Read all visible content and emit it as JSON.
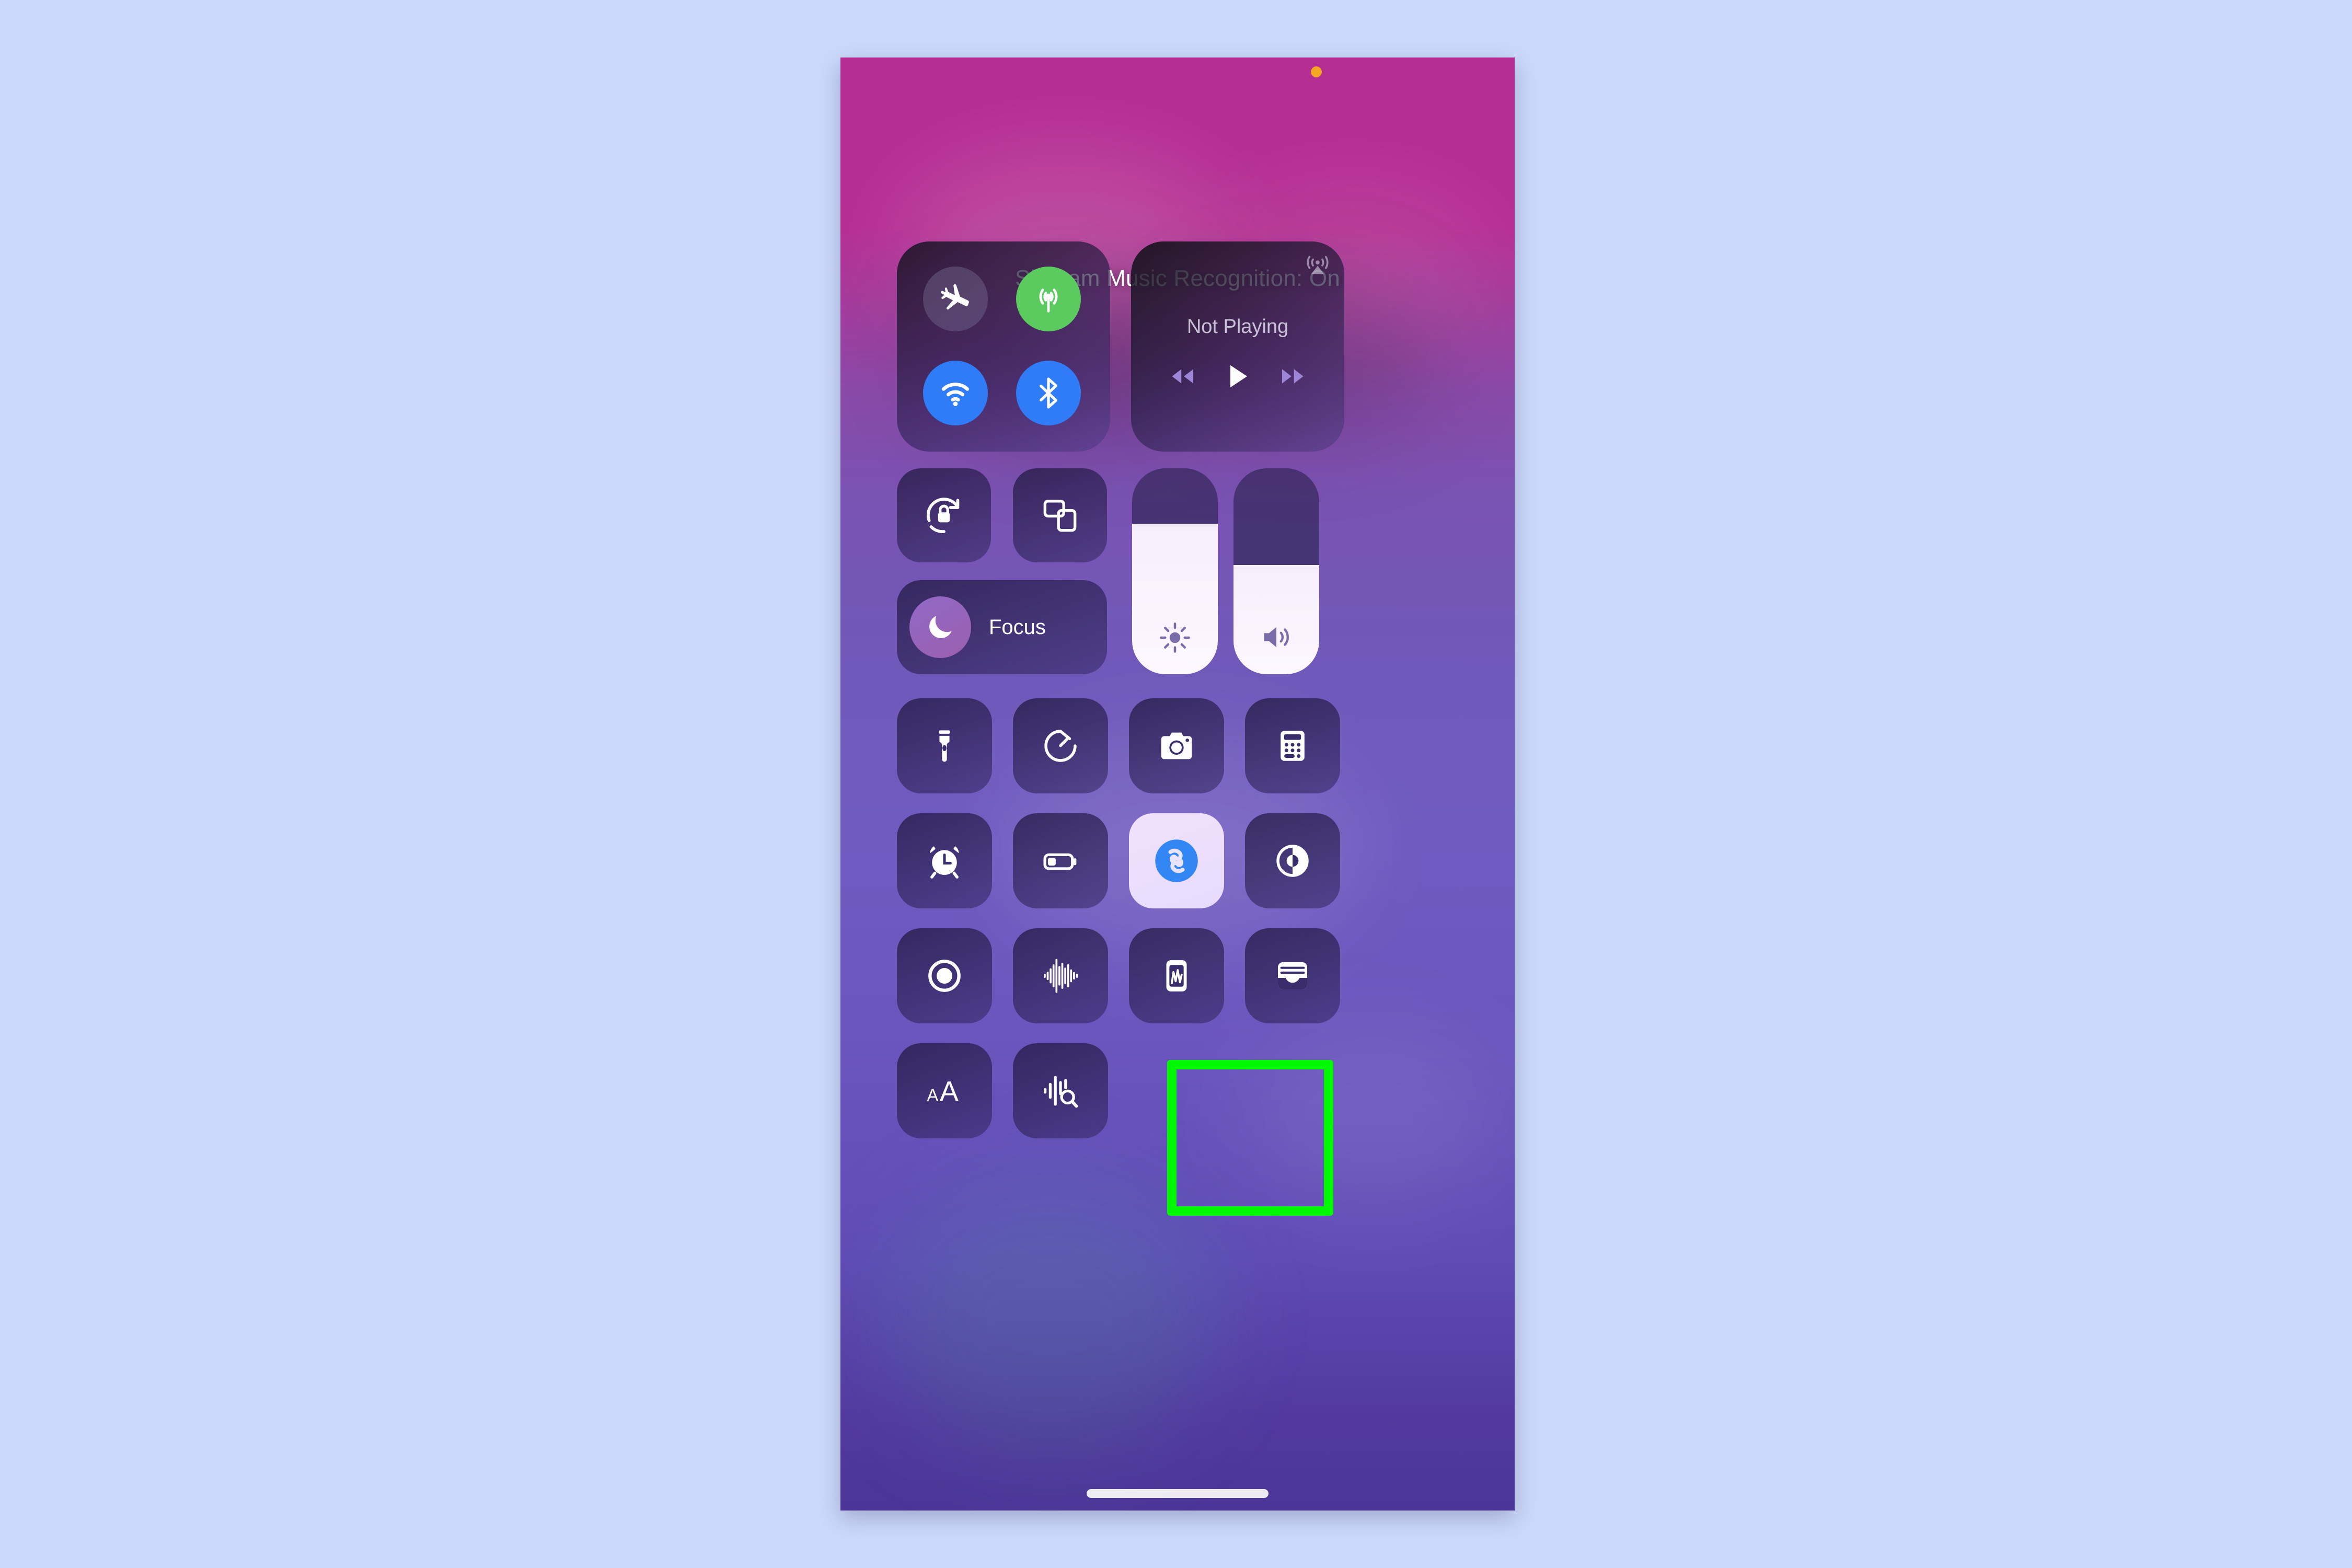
{
  "page": {
    "background_color": "#ccd9fa",
    "device": "iPhone Control Center"
  },
  "screen": {
    "gradient_top_color": "#b52e93",
    "gradient_bottom_color": "#4c3597"
  },
  "status": {
    "banner_text": "Shazam Music Recognition: On",
    "privacy_indicator": "microphone-in-use-dot",
    "privacy_indicator_color": "#f5a623"
  },
  "connectivity": {
    "toggles": [
      {
        "name": "airplane-mode",
        "label": "Airplane Mode",
        "state": "off",
        "color": "#787096"
      },
      {
        "name": "cellular-data",
        "label": "Cellular Data",
        "state": "on",
        "color": "#5bcb5f"
      },
      {
        "name": "wifi",
        "label": "Wi-Fi",
        "state": "on",
        "color": "#2f7cf6"
      },
      {
        "name": "bluetooth",
        "label": "Bluetooth",
        "state": "on",
        "color": "#2f7cf6"
      }
    ]
  },
  "media": {
    "title": "Not Playing",
    "airplay_label": "AirPlay",
    "controls": [
      {
        "name": "rewind",
        "label": "Rewind"
      },
      {
        "name": "play",
        "label": "Play"
      },
      {
        "name": "fast-forward",
        "label": "Fast Forward"
      }
    ]
  },
  "quick_controls": {
    "rotation_lock": {
      "label": "Portrait Orientation Lock",
      "state": "off"
    },
    "screen_mirroring": {
      "label": "Screen Mirroring",
      "state": "off"
    },
    "focus": {
      "label": "Focus",
      "state": "off"
    }
  },
  "sliders": [
    {
      "name": "brightness",
      "label": "Brightness",
      "value_percent": 73
    },
    {
      "name": "volume",
      "label": "Volume",
      "value_percent": 53
    }
  ],
  "tiles": [
    {
      "name": "flashlight",
      "label": "Flashlight",
      "state": "off"
    },
    {
      "name": "timer",
      "label": "Timer",
      "state": "off"
    },
    {
      "name": "camera",
      "label": "Camera",
      "state": "off"
    },
    {
      "name": "calculator",
      "label": "Calculator",
      "state": "off"
    },
    {
      "name": "alarm",
      "label": "Alarm",
      "state": "off"
    },
    {
      "name": "low-power-mode",
      "label": "Low Power Mode",
      "state": "off"
    },
    {
      "name": "shazam",
      "label": "Music Recognition",
      "state": "on"
    },
    {
      "name": "dark-mode",
      "label": "Dark Mode",
      "state": "off"
    },
    {
      "name": "screen-recording",
      "label": "Screen Recording",
      "state": "off"
    },
    {
      "name": "hearing",
      "label": "Hearing",
      "state": "off"
    },
    {
      "name": "voice-memos",
      "label": "Voice Memos",
      "state": "off"
    },
    {
      "name": "wallet",
      "label": "Wallet",
      "state": "off"
    },
    {
      "name": "text-size",
      "label": "Text Size",
      "state": "off"
    },
    {
      "name": "sound-recognition",
      "label": "Sound Recognition",
      "state": "off"
    }
  ],
  "highlight": {
    "target": "shazam",
    "color": "#00f900",
    "label": "Music Recognition button highlighted"
  },
  "home_indicator": {
    "label": "Home Indicator"
  }
}
